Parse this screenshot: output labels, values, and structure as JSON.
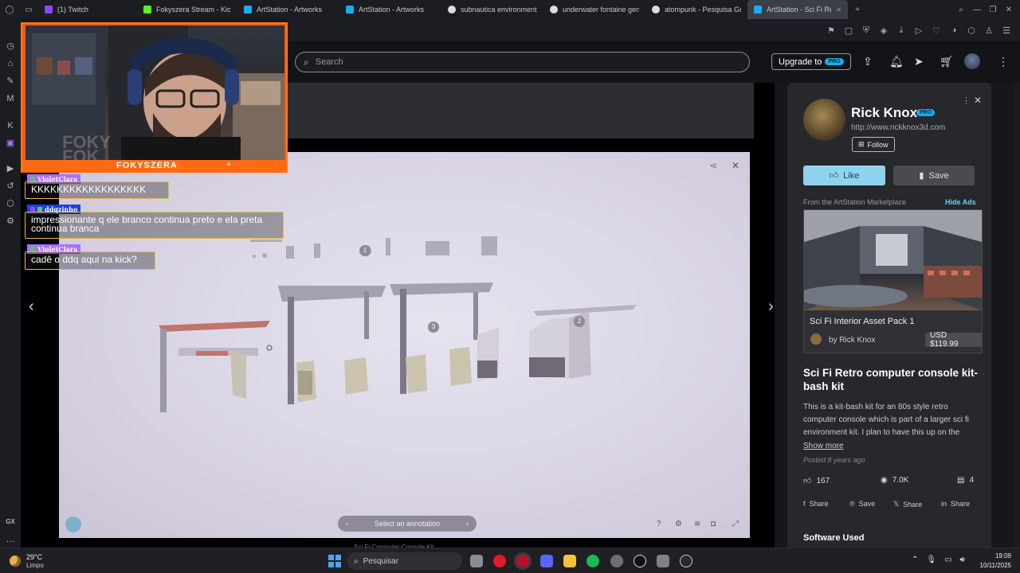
{
  "browser": {
    "tabs": [
      {
        "label": "(1) Twitch",
        "favicon_color": "#9146ff"
      },
      {
        "label": "Fokyszera Stream - Kick",
        "favicon_color": "#53fc18"
      },
      {
        "label": "ArtStation - Artworks",
        "favicon_color": "#13aff0"
      },
      {
        "label": "ArtStation - Artworks",
        "favicon_color": "#13aff0"
      },
      {
        "label": "subnautica environments",
        "favicon_color": "#dddddd"
      },
      {
        "label": "underwater fontaine gens",
        "favicon_color": "#dddddd"
      },
      {
        "label": "atompunk - Pesquisa Goo",
        "favicon_color": "#dddddd"
      },
      {
        "label": "ArtStation - Sci Fi Retro c",
        "favicon_color": "#13aff0",
        "active": true
      }
    ],
    "new_tab": "+"
  },
  "site_header": {
    "search_placeholder": "Search",
    "upgrade_label": "Upgrade to",
    "pro_badge": "PRO"
  },
  "viewer": {
    "annotation_prompt": "Select an annotation",
    "annotation_prev": "‹",
    "annotation_next": "›",
    "caption_below": "Sci Fi Computer Console Kit",
    "hotspots": [
      "1",
      "2",
      "3"
    ]
  },
  "panel": {
    "artist_name": "Rick Knox",
    "artist_pro": "PRO",
    "artist_url": "http://www.rickknox3d.com",
    "follow_label": "Follow",
    "like_label": "Like",
    "save_label": "Save",
    "marketplace_label": "From the ArtStation Marketplace",
    "hide_ads": "Hide Ads",
    "ad": {
      "title": "Sci Fi Interior Asset Pack 1",
      "by": "by Rick Knox",
      "price": "USD $119.99"
    },
    "project_title": "Sci Fi Retro computer console kit-bash kit",
    "description": "This is a kit-bash kit for an 80s style retro computer console which is part of a larger sci fi environment kit. I plan to have this up on the",
    "show_more": "Show more",
    "posted": "Posted 8 years ago",
    "stats": {
      "likes": "167",
      "views": "7.0K",
      "comments": "4"
    },
    "share": [
      {
        "icon": "facebook-icon",
        "label": "Share"
      },
      {
        "icon": "pinterest-icon",
        "label": "Save"
      },
      {
        "icon": "x-icon",
        "label": "Share"
      },
      {
        "icon": "linkedin-icon",
        "label": "Share"
      }
    ],
    "software_heading": "Software Used"
  },
  "stream": {
    "streamer_name": "FOKYSZERA",
    "ghost_text_1": "FOKY",
    "ghost_text_2": "FOK"
  },
  "chat": [
    {
      "user": "VioletClara",
      "user_color": "#a970ff",
      "message": "KKKKKKKKKKKKKKKKKK"
    },
    {
      "user": "ddqzinho",
      "user_color": "#1f3fe0",
      "message": "impressionante q ele branco continua preto e ela preta continua branca"
    },
    {
      "user": "VioletClara",
      "user_color": "#a970ff",
      "message": "cadê o ddq aqui na kick?"
    }
  ],
  "taskbar": {
    "weather_temp": "29°C",
    "weather_desc": "Limpo",
    "search_placeholder": "Pesquisar",
    "time": "19:09",
    "date": "10/11/2025"
  },
  "sidebar_label": "GX",
  "colors": {
    "accent": "#13aff0",
    "like_button": "#8fd3ef",
    "stream_orange": "#f25a14",
    "chat_border": "#e5b94a"
  }
}
